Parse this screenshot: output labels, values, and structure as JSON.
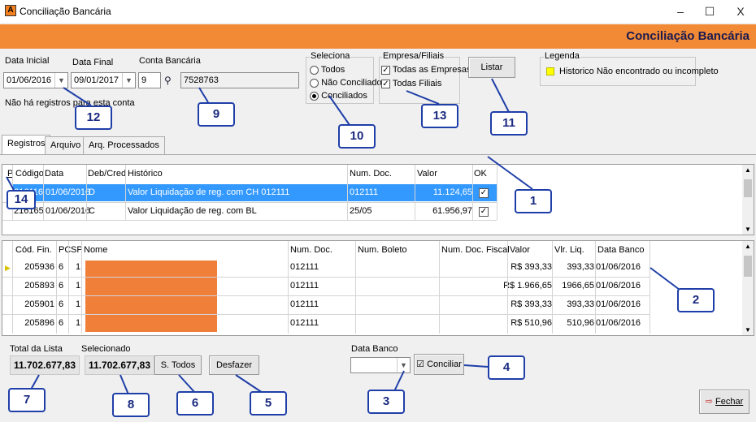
{
  "window": {
    "title": "Conciliação Bancária",
    "min": "–",
    "max": "☐",
    "close": "X"
  },
  "banner": "Conciliação Bancária",
  "filters": {
    "data_inicial_label": "Data Inicial",
    "data_inicial": "01/06/2016",
    "data_final_label": "Data Final",
    "data_final": "09/01/2017",
    "conta_label": "Conta Bancária",
    "conta_num": "9",
    "conta_desc": "7528763",
    "message": "Não há registros para esta conta"
  },
  "seleciona": {
    "title": "Seleciona",
    "options": [
      "Todos",
      "Não Conciliados",
      "Conciliados"
    ]
  },
  "empresa": {
    "title": "Empresa/Filiais",
    "opt1": "Todas as Empresas",
    "opt2": "Todas Filiais"
  },
  "listar_label": "Listar",
  "legenda": {
    "title": "Legenda",
    "text": "Historico Não encontrado ou incompleto",
    "color": "#ffff00"
  },
  "tabs": [
    "Registros",
    "Arquivo",
    "Arq. Processados"
  ],
  "grid1": {
    "headers": [
      "P",
      "Código",
      "Data",
      "Deb/Cred",
      "Histórico",
      "Num. Doc.",
      "Valor",
      "OK"
    ],
    "rows": [
      {
        "codigo": "216116",
        "data": "01/06/2016",
        "dc": "D",
        "historico": "Valor Liquidação de reg. com CH 012111",
        "num_doc": "012111",
        "valor": "11.124,65",
        "ok": "✓"
      },
      {
        "codigo": "216165",
        "data": "01/06/2016",
        "dc": "C",
        "historico": "Valor Liquidação de reg. com BL",
        "num_doc": "25/05",
        "valor": "61.956,97",
        "ok": "✓"
      }
    ]
  },
  "grid2": {
    "headers": [
      "Cód. Fin.",
      "PC",
      "SP",
      "Nome",
      "Num. Doc.",
      "Num. Boleto",
      "Num. Doc. Fiscal",
      "Valor",
      "Vlr. Liq.",
      "Data Banco"
    ],
    "rows": [
      {
        "cod": "205936",
        "pc": "6",
        "sp": "1",
        "num_doc": "012111",
        "valor": "R$ 393,33",
        "liq": "393,33",
        "data": "01/06/2016"
      },
      {
        "cod": "205893",
        "pc": "6",
        "sp": "1",
        "num_doc": "012111",
        "valor": "R$ 1.966,65",
        "liq": "1966,65",
        "data": "01/06/2016"
      },
      {
        "cod": "205901",
        "pc": "6",
        "sp": "1",
        "num_doc": "012111",
        "valor": "R$ 393,33",
        "liq": "393,33",
        "data": "01/06/2016"
      },
      {
        "cod": "205896",
        "pc": "6",
        "sp": "1",
        "num_doc": "012111",
        "valor": "R$ 510,96",
        "liq": "510,96",
        "data": "01/06/2016"
      }
    ],
    "redaction_color": "#f07f3a"
  },
  "footer": {
    "total_label": "Total da Lista",
    "total": "11.702.677,83",
    "sel_label": "Selecionado",
    "sel": "11.702.677,83",
    "s_todos": "S. Todos",
    "desfazer": "Desfazer",
    "data_banco_label": "Data Banco",
    "conciliar": "Conciliar",
    "fechar": "Fechar"
  },
  "callouts": [
    "1",
    "2",
    "3",
    "4",
    "5",
    "6",
    "7",
    "8",
    "9",
    "10",
    "11",
    "12",
    "13",
    "14"
  ]
}
